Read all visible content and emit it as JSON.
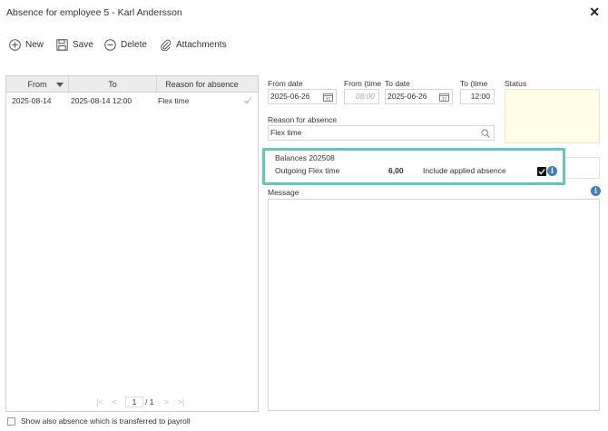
{
  "window": {
    "title": "Absence for employee 5 - Karl Andersson",
    "close_symbol": "✕"
  },
  "toolbar": {
    "new_label": "New",
    "save_label": "Save",
    "delete_label": "Delete",
    "attachments_label": "Attachments"
  },
  "grid": {
    "columns": [
      "From",
      "To",
      "Reason for absence"
    ],
    "rows": [
      {
        "from": "2025-08-14",
        "to": "2025-08-14 12:00",
        "reason": "Flex time"
      }
    ]
  },
  "pager": {
    "current": "1",
    "separator": "/",
    "total": "1"
  },
  "bottom": {
    "show_transferred_label": "Show also absence which is transferred to payroll",
    "show_transferred_checked": false
  },
  "form": {
    "from_date_label": "From date",
    "from_date_value": "2025-06-26",
    "from_time_label": "From (time",
    "from_time_value": "08:00",
    "to_date_label": "To date",
    "to_date_value": "2025-06-26",
    "to_time_label": "To (time",
    "to_time_value": "12:00",
    "status_label": "Status",
    "reason_label": "Reason for absence",
    "reason_value": "Flex time",
    "message_label": "Message"
  },
  "balances": {
    "title": "Balances 202508",
    "name": "Outgoing Flex time",
    "value": "6,00",
    "include_label": "Include applied absence",
    "include_checked": true
  },
  "colors": {
    "highlight": "#5cc9bf",
    "status_bg": "#fffde6",
    "info": "#3b7fc0"
  },
  "icons": [
    "plus-circle-icon",
    "floppy-disk-icon",
    "minus-circle-icon",
    "paperclip-icon",
    "calendar-icon",
    "search-icon",
    "info-icon",
    "check-icon",
    "close-icon"
  ]
}
